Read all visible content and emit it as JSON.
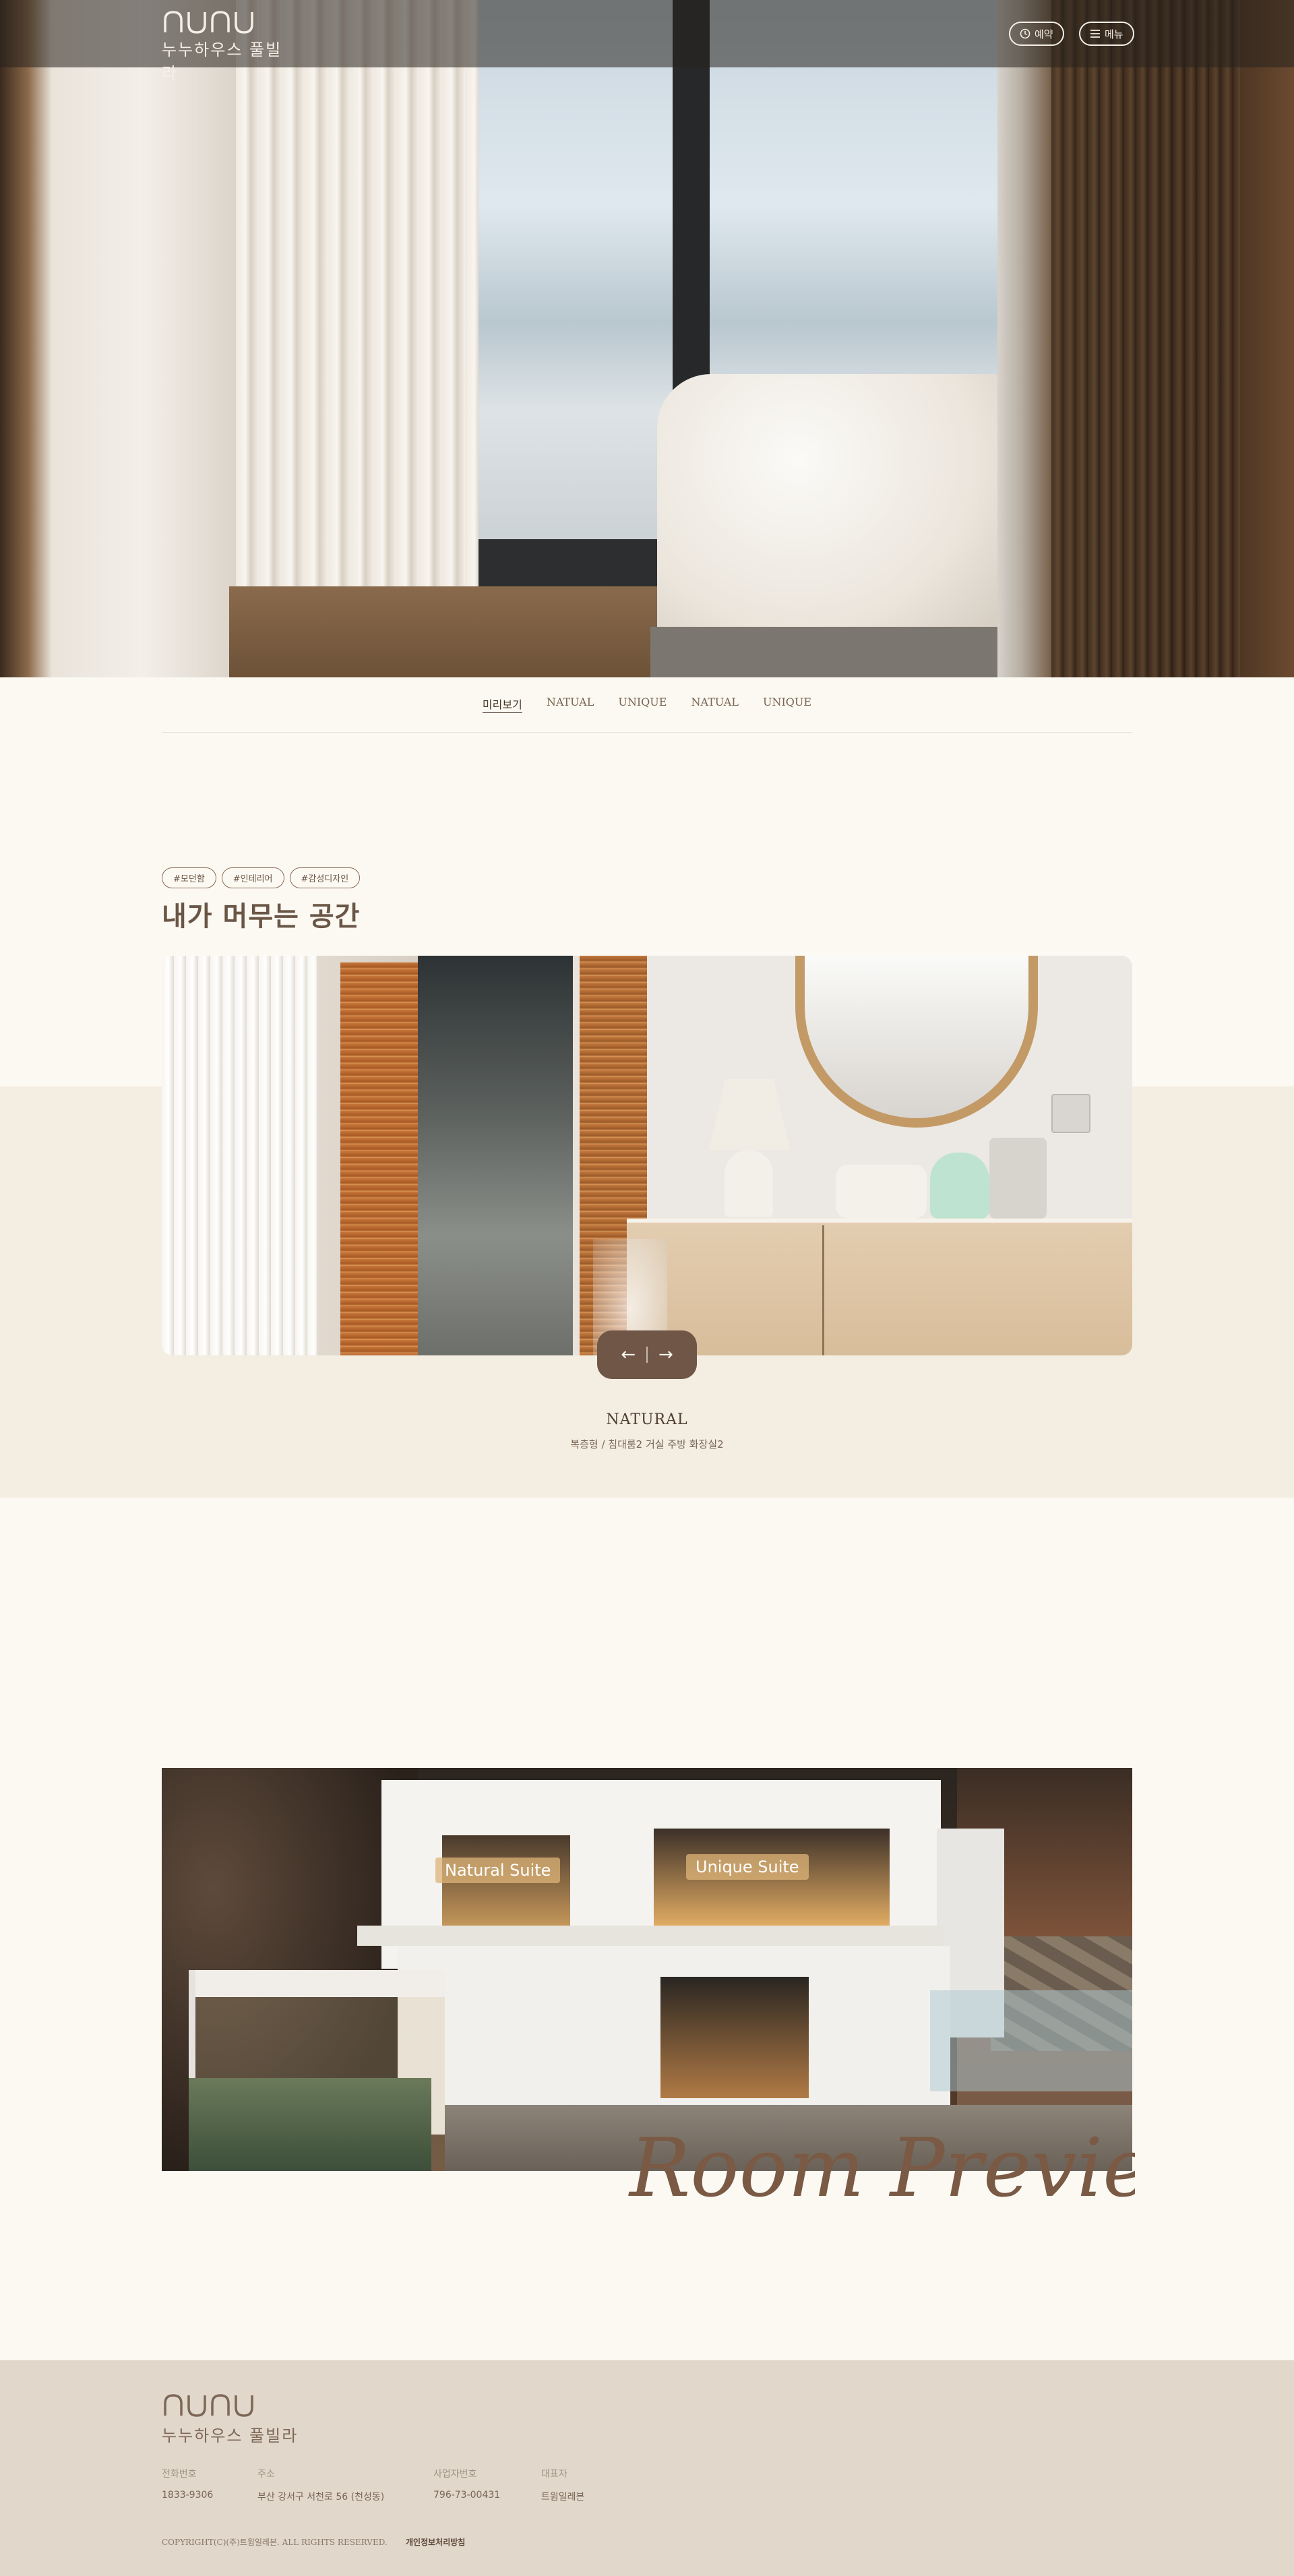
{
  "header": {
    "logo_mark": "nunu",
    "logo_text": "누누하우스 풀빌라",
    "reserve_label": "예약",
    "menu_label": "메뉴"
  },
  "tabs": [
    {
      "label": "미리보기",
      "active": true
    },
    {
      "label": "NATUAL",
      "active": false
    },
    {
      "label": "UNIQUE",
      "active": false
    },
    {
      "label": "NATUAL",
      "active": false
    },
    {
      "label": "UNIQUE",
      "active": false
    }
  ],
  "space_section": {
    "hashtags": [
      "#모던함",
      "#인테리어",
      "#감성디자인"
    ],
    "title": "내가 머무는 공간",
    "slider_prev": "←",
    "slider_next": "→",
    "room_name": "NATURAL",
    "room_desc": "복층형 / 침대룸2 거실 주방 화장실2"
  },
  "preview_section": {
    "label_left": "Natural Suite",
    "label_right": "Unique Suite",
    "script_text": "Room Preview"
  },
  "footer": {
    "logo_mark": "nunu",
    "logo_text": "누누하우스 풀빌라",
    "phone_label": "전화번호",
    "phone": "1833-9306",
    "address_label": "주소",
    "address": "부산 강서구 서천로 56 (천성동)",
    "bizno_label": "사업자번호",
    "bizno": "796-73-00431",
    "ceo_label": "대표자",
    "ceo": "트윔일레븐",
    "copyright": "COPYRIGHT(C)(주)트윔일레븐. ALL RIGHTS RESERVED.",
    "privacy_label": "개인정보처리방침"
  },
  "colors": {
    "background": "#fbf9f2",
    "beige_band": "#f3ede2",
    "footer_bg": "#e1d7cb",
    "accent_brown": "#6f5646",
    "text_brown": "#5a4636"
  }
}
